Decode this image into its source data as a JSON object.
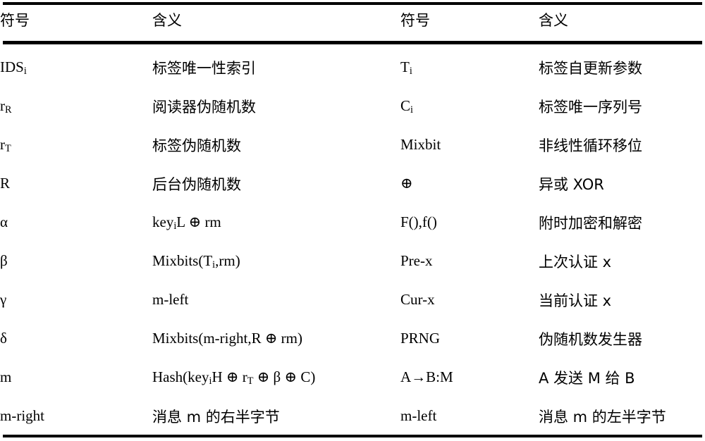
{
  "document": {
    "type": "symbol-definition-table",
    "columns": [
      "符号",
      "含义",
      "符号",
      "含义"
    ],
    "rules": {
      "top": true,
      "under_header": true,
      "bottom": true
    }
  },
  "header": {
    "symbol_left": "符号",
    "meaning_left": "含义",
    "symbol_right": "符号",
    "meaning_right": "含义"
  },
  "rows": [
    {
      "symbol_left": "IDS",
      "symbol_left_sub": "i",
      "meaning_left": "标签唯一性索引",
      "symbol_right": "T",
      "symbol_right_sub": "i",
      "meaning_right": "标签自更新参数"
    },
    {
      "symbol_left": "r",
      "symbol_left_sub": "R",
      "meaning_left": "阅读器伪随机数",
      "symbol_right": "C",
      "symbol_right_sub": "i",
      "meaning_right": "标签唯一序列号"
    },
    {
      "symbol_left": "r",
      "symbol_left_sub": "T",
      "meaning_left": "标签伪随机数",
      "symbol_right": "Mixbit",
      "symbol_right_sub": "",
      "meaning_right": "非线性循环移位"
    },
    {
      "symbol_left": "R",
      "symbol_left_sub": "",
      "meaning_left": "后台伪随机数",
      "symbol_right": "⊕",
      "symbol_right_sub": "",
      "meaning_right": "异或 XOR"
    },
    {
      "symbol_left": "α",
      "symbol_left_sub": "",
      "meaning_left": "key L ⊕ rm",
      "meaning_left_parts": [
        "key",
        "i",
        "L ⊕ rm"
      ],
      "symbol_right": "F(),f()",
      "symbol_right_sub": "",
      "meaning_right": "附时加密和解密"
    },
    {
      "symbol_left": "β",
      "symbol_left_sub": "",
      "meaning_left": "Mixbits(T,rm)",
      "meaning_left_parts": [
        "Mixbits(T",
        "i",
        ",rm)"
      ],
      "symbol_right": "Pre-x",
      "symbol_right_sub": "",
      "meaning_right": "上次认证 x"
    },
    {
      "symbol_left": "γ",
      "symbol_left_sub": "",
      "meaning_left": "m-left",
      "symbol_right": "Cur-x",
      "symbol_right_sub": "",
      "meaning_right": "当前认证 x"
    },
    {
      "symbol_left": "δ",
      "symbol_left_sub": "",
      "meaning_left": "Mixbits(m-right,R ⊕ rm)",
      "symbol_right": "PRNG",
      "symbol_right_sub": "",
      "meaning_right": "伪随机数发生器"
    },
    {
      "symbol_left": "m",
      "symbol_left_sub": "",
      "meaning_left": "Hash(keyH ⊕ r ⊕ β ⊕ C)",
      "meaning_left_parts": [
        "Hash(key",
        "i",
        "H ⊕ r",
        "T",
        " ⊕ β ⊕ C)"
      ],
      "symbol_right": "A→B:M",
      "symbol_right_sub": "",
      "meaning_right": "A 发送 M 给 B"
    },
    {
      "symbol_left": "m-right",
      "symbol_left_sub": "",
      "meaning_left": "消息 m 的右半字节",
      "symbol_right": "m-left",
      "symbol_right_sub": "",
      "meaning_right": "消息 m 的左半字节"
    }
  ]
}
